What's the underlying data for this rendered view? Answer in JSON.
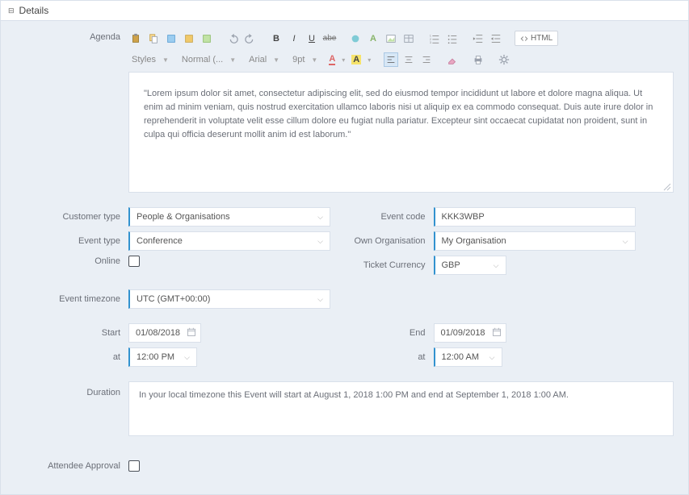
{
  "panel": {
    "title": "Details"
  },
  "fields": {
    "agenda_label": "Agenda",
    "customer_type_label": "Customer type",
    "event_type_label": "Event type",
    "online_label": "Online",
    "event_timezone_label": "Event timezone",
    "start_label": "Start",
    "at_label": "at",
    "end_label": "End",
    "duration_label": "Duration",
    "attendee_approval_label": "Attendee Approval",
    "event_code_label": "Event code",
    "own_organisation_label": "Own Organisation",
    "ticket_currency_label": "Ticket Currency"
  },
  "values": {
    "customer_type": "People & Organisations",
    "event_type": "Conference",
    "event_timezone": "UTC (GMT+00:00)",
    "start_date": "01/08/2018",
    "start_time": "12:00 PM",
    "end_date": "01/09/2018",
    "end_time": "12:00 AM",
    "event_code": "KKK3WBP",
    "own_organisation": "My Organisation",
    "ticket_currency": "GBP",
    "duration_text": "In your local timezone this Event will start at August 1, 2018 1:00 PM and end at September 1, 2018 1:00 AM.",
    "agenda_text": "\"Lorem ipsum dolor sit amet, consectetur adipiscing elit, sed do eiusmod tempor incididunt ut labore et dolore magna aliqua. Ut enim ad minim veniam, quis nostrud exercitation ullamco laboris nisi ut aliquip ex ea commodo consequat. Duis aute irure dolor in reprehenderit in voluptate velit esse cillum dolore eu fugiat nulla pariatur. Excepteur sint occaecat cupidatat non proident, sunt in culpa qui officia deserunt mollit anim id est laborum.\""
  },
  "toolbar": {
    "styles": "Styles",
    "format": "Normal (...",
    "font": "Arial",
    "size": "9pt",
    "html": "HTML",
    "a_upper": "A",
    "a_lower": "A"
  }
}
